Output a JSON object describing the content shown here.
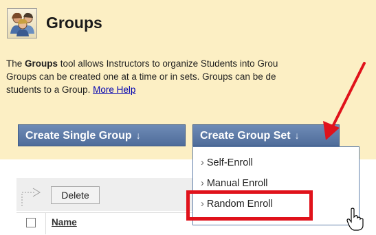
{
  "header": {
    "title": "Groups",
    "icon": "users-group-icon"
  },
  "description": {
    "line1_prefix": "The ",
    "line1_bold": "Groups",
    "line1_rest": " tool allows Instructors to organize Students into Grou",
    "line2": "Groups can be created one at a time or in sets. Groups can be de",
    "line3_text": "students to a Group. ",
    "more_help": "More Help"
  },
  "actions": {
    "create_single_group": "Create Single Group",
    "create_group_set": "Create Group Set"
  },
  "group_set_menu": {
    "items": [
      {
        "label": "Self-Enroll"
      },
      {
        "label": "Manual Enroll"
      },
      {
        "label": "Random Enroll",
        "highlighted": true
      }
    ]
  },
  "list_toolbar": {
    "delete_label": "Delete"
  },
  "table": {
    "columns": [
      {
        "label": "Name"
      }
    ]
  },
  "colors": {
    "header_bg": "#fcefc4",
    "button_blue": "#5a78a6",
    "highlight_red": "#e0121b"
  }
}
